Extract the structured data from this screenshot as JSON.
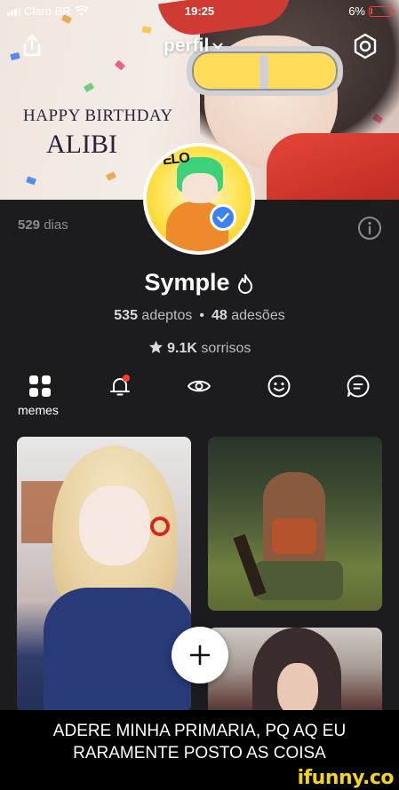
{
  "status_bar": {
    "carrier": "Claro BR",
    "time": "19:25",
    "battery": "6%"
  },
  "header": {
    "title": "perfil",
    "banner_text_line1": "HAPPY BIRTHDAY",
    "banner_text_line2": "ALIBI"
  },
  "profile": {
    "days_value": "529",
    "days_label": "dias",
    "name": "Symple",
    "followers_value": "535",
    "followers_label": "adeptos",
    "memberships_value": "48",
    "memberships_label": "adesões",
    "smiles_value": "9.1K",
    "smiles_label": "sorrisos"
  },
  "tabs": [
    {
      "icon": "grid-icon",
      "label": "memes",
      "active": true
    },
    {
      "icon": "bell-icon",
      "has_notification": true
    },
    {
      "icon": "eye-icon"
    },
    {
      "icon": "smiley-icon"
    },
    {
      "icon": "comment-icon"
    }
  ],
  "caption": {
    "line1": "ADERE MINHA PRIMARIA, PQ AQ EU",
    "line2": "RARAMENTE POSTO AS COISA"
  },
  "watermark": "ifunny.co",
  "colors": {
    "background": "#1c1c1e",
    "verified": "#3b82f6",
    "notification_dot": "#ff3b30",
    "watermark": "#f4d31b"
  }
}
